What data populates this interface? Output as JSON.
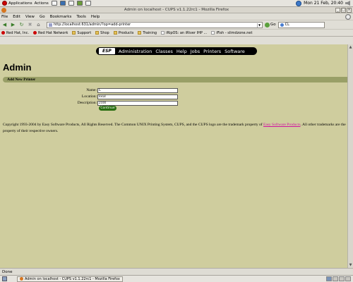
{
  "top_panel": {
    "applications": "Applications",
    "actions": "Actions",
    "clock": "Mon 21 Feb, 20:40"
  },
  "window": {
    "title": "Admin on localhost - CUPS v1.1.22rc1 - Mozilla Firefox"
  },
  "menubar": [
    "File",
    "Edit",
    "View",
    "Go",
    "Bookmarks",
    "Tools",
    "Help"
  ],
  "navbar": {
    "url": "http://localhost:631/admin/?op=add-printer",
    "go_label": "Go",
    "search_value": "CL"
  },
  "bookmarks": [
    {
      "label": "Red Hat, Inc.",
      "icon": "redhat-icon"
    },
    {
      "label": "Red Hat Network",
      "icon": "redhat-icon"
    },
    {
      "label": "Support",
      "icon": "folder-icon"
    },
    {
      "label": "Shop",
      "icon": "folder-icon"
    },
    {
      "label": "Products",
      "icon": "folder-icon"
    },
    {
      "label": "Training",
      "icon": "folder-icon"
    },
    {
      "label": "iRipOS: an iRiver IHP ...",
      "icon": "page-icon"
    },
    {
      "label": "iFish - slimdzone.net",
      "icon": "page-icon"
    }
  ],
  "cups_nav": {
    "logo": "ESP",
    "links": [
      "Administration",
      "Classes",
      "Help",
      "Jobs",
      "Printers",
      "Software"
    ]
  },
  "page": {
    "title": "Admin",
    "section_title": "Add New Printer",
    "fields": [
      {
        "label": "Name:",
        "value": "L"
      },
      {
        "label": "Location:",
        "value": "local"
      },
      {
        "label": "Description:",
        "value": "2100"
      }
    ],
    "continue_label": "Continue",
    "copyright_before": "Copyright 1993-2004 by Easy Software Products, All Rights Reserved. The Common UNIX Printing System, CUPS, and the CUPS logo are the trademark property of ",
    "copyright_link": "Easy Software Products",
    "copyright_after": ". All other trademarks are the property of their respective owners."
  },
  "statusbar": {
    "text": "Done"
  },
  "taskbar": {
    "task_label": "Admin on localhost - CUPS v1.1.22rc1 - Mozilla Firefox"
  },
  "colors": {
    "content_bg": "#cfcd9e",
    "section_bar": "#999f67",
    "continue_button": "#2a6e12",
    "link": "#d011a0"
  }
}
